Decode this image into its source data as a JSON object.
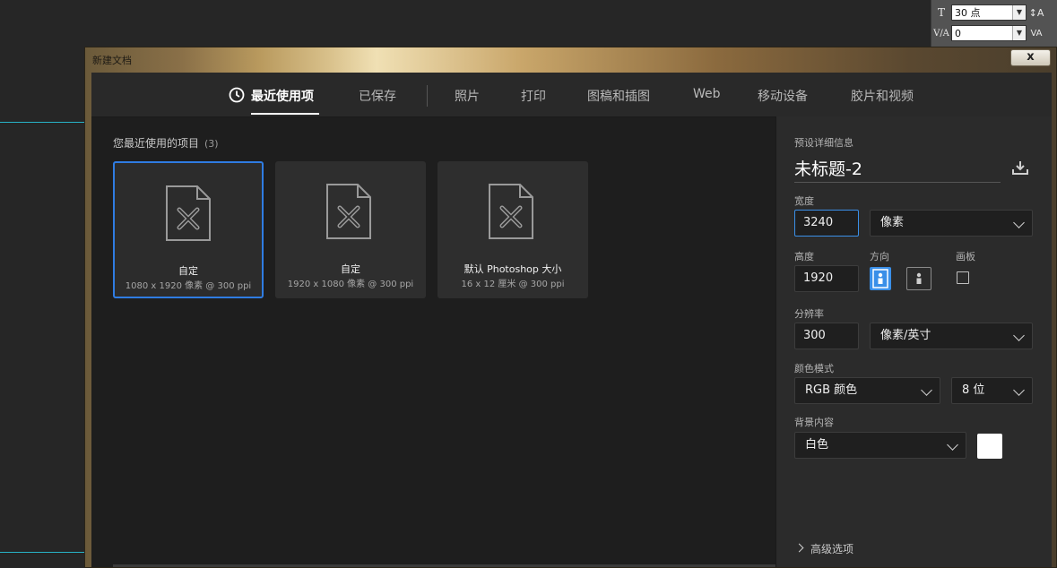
{
  "options_bar": {
    "font_size": "30 点",
    "tracking": "0"
  },
  "dialog": {
    "title": "新建文档",
    "close_label": "x"
  },
  "tabs": [
    {
      "label": "最近使用项"
    },
    {
      "label": "已保存"
    },
    {
      "label": "照片"
    },
    {
      "label": "打印"
    },
    {
      "label": "图稿和插图"
    },
    {
      "label": "Web"
    },
    {
      "label": "移动设备"
    },
    {
      "label": "胶片和视频"
    }
  ],
  "recent": {
    "heading": "您最近使用的项目",
    "count": "(3)",
    "items": [
      {
        "name": "自定",
        "dims": "1080 x 1920 像素 @ 300 ppi"
      },
      {
        "name": "自定",
        "dims": "1920 x 1080 像素 @ 300 ppi"
      },
      {
        "name": "默认 Photoshop 大小",
        "dims": "16 x 12 厘米 @ 300 ppi"
      }
    ]
  },
  "details": {
    "heading": "预设详细信息",
    "doc_name": "未标题-2",
    "width_label": "宽度",
    "width_value": "3240",
    "width_unit": "像素",
    "height_label": "高度",
    "height_value": "1920",
    "orientation_label": "方向",
    "artboard_label": "画板",
    "resolution_label": "分辨率",
    "resolution_value": "300",
    "resolution_unit": "像素/英寸",
    "color_mode_label": "颜色模式",
    "color_mode_value": "RGB 颜色",
    "bit_depth_value": "8 位",
    "background_label": "背景内容",
    "background_value": "白色",
    "background_color": "#ffffff",
    "advanced_label": "高级选项"
  },
  "colors": {
    "accent": "#2f7ce2",
    "panel": "#2b2b2b",
    "dialog_bg": "#1e1e1e"
  }
}
